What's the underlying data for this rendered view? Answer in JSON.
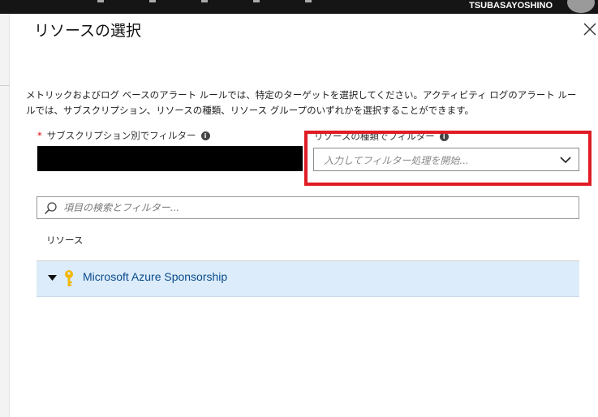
{
  "header": {
    "username": "TSUBASAYOSHINO"
  },
  "blade": {
    "title": "リソースの選択",
    "description_line1": "メトリックおよびログ ベースのアラート ルールでは、特定のターゲットを選択してください。アクティビティ ログのアラート ルー",
    "description_line2": "ルでは、サブスクリプション、リソースの種類、リソース グループのいずれかを選択することができます。"
  },
  "filters": {
    "subscription_label": "サブスクリプション別でフィルター",
    "subscription_required_marker": "*",
    "resource_type_label": "リソースの種類でフィルター",
    "resource_type_placeholder": "入力してフィルター処理を開始..."
  },
  "search": {
    "placeholder": "項目の検索とフィルター..."
  },
  "list": {
    "column_header": "リソース",
    "items": [
      {
        "name": "Microsoft Azure Sponsorship",
        "icon": "key-icon",
        "expanded": true
      }
    ]
  },
  "colors": {
    "highlight": "#e01b24",
    "selected_row": "#dcecfa",
    "link_text": "#0a4a8c",
    "topbar": "#151515"
  }
}
